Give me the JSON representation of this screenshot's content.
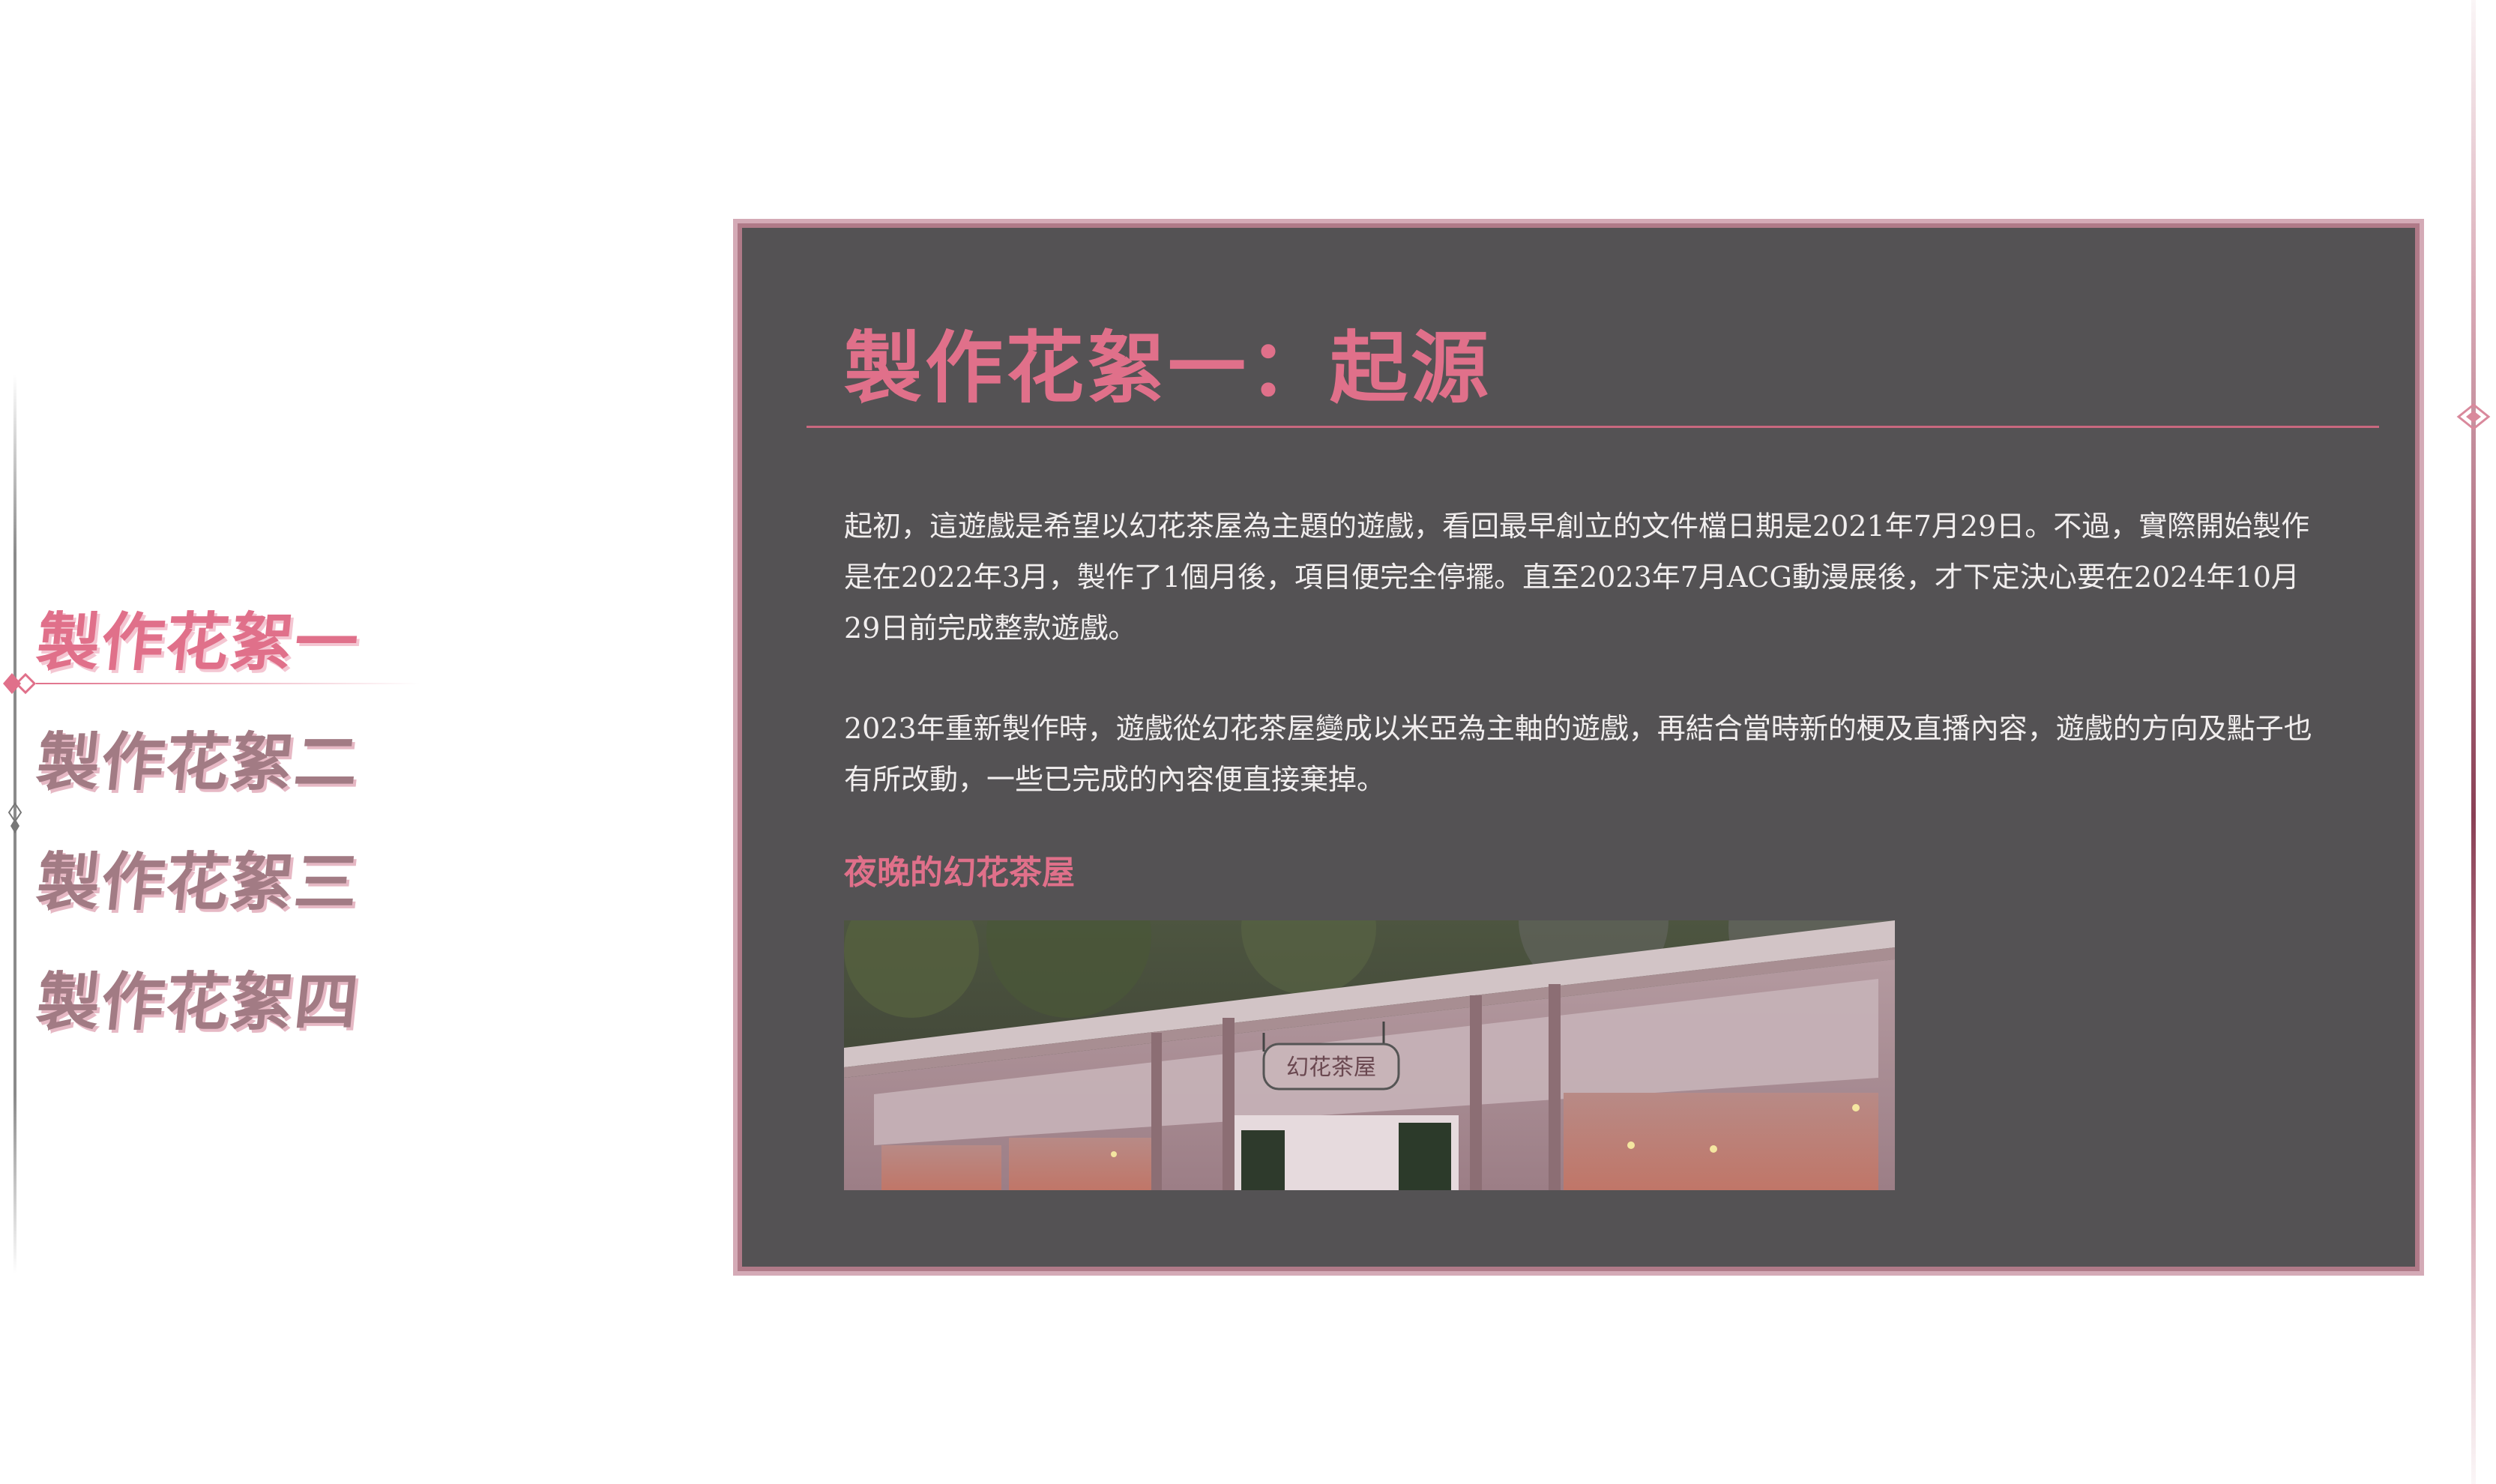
{
  "nav": {
    "items": [
      {
        "label": "製作花絮一",
        "active": true
      },
      {
        "label": "製作花絮二",
        "active": false
      },
      {
        "label": "製作花絮三",
        "active": false
      },
      {
        "label": "製作花絮四",
        "active": false
      }
    ]
  },
  "article": {
    "title": "製作花絮一：起源",
    "paragraphs": [
      "起初，這遊戲是希望以幻花茶屋為主題的遊戲，看回最早創立的文件檔日期是2021年7月29日。不過，實際開始製作是在2022年3月，製作了1個月後，項目便完全停擺。直至2023年7月ACG動漫展後，才下定決心要在2024年10月29日前完成整款遊戲。",
      "2023年重新製作時，遊戲從幻花茶屋變成以米亞為主軸的遊戲，再結合當時新的梗及直播內容，遊戲的方向及點子也有所改動，一些已完成的內容便直接棄掉。"
    ],
    "image_caption": "夜晚的幻花茶屋",
    "image_sign_text": "幻花茶屋"
  },
  "colors": {
    "accent": "#e0708a",
    "card_bg": "#545254",
    "nav_inactive": "#a27b84",
    "card_border": "#d4aab6"
  }
}
